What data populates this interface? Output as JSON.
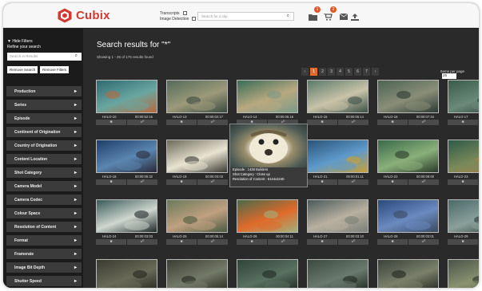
{
  "header": {
    "brand": "Cubix",
    "options": [
      {
        "label": "Transcripts"
      },
      {
        "label": "Image Detection"
      }
    ],
    "search_placeholder": "Search for a clip",
    "badges": {
      "folders": "1",
      "cart": "2"
    }
  },
  "sidebar": {
    "hide_filters": "▼ Hide Filters",
    "refine_label": "Refine your search",
    "search_placeholder": "Search in Results",
    "remove_search": "Remove Search",
    "remove_filters": "Remove Filters",
    "filters": [
      "Production",
      "Series",
      "Episode",
      "Continent of Origination",
      "Country of Origination",
      "Content Location",
      "Shot Category",
      "Camera Model",
      "Camera Codec",
      "Colour Space",
      "Resolution of Content",
      "Format",
      "Framerate",
      "Image Bit Depth",
      "Shutter Speed"
    ]
  },
  "main": {
    "title": "Search results for \"*\"",
    "showing": "Showing 1 - 25 of 175 results found",
    "pages": [
      "‹",
      "1",
      "2",
      "3",
      "4",
      "5",
      "6",
      "7",
      "›"
    ],
    "active_page": "1",
    "items_per_page_label": "Items per page",
    "items_per_page_value": "25",
    "items": [
      {
        "id": "HALO-10",
        "time": "00:00:52:16"
      },
      {
        "id": "HALO-13",
        "time": "00:00:02:17"
      },
      {
        "id": "HALO-14",
        "time": "00:00:05:18"
      },
      {
        "id": "HALO-15",
        "time": "00:00:06:14"
      },
      {
        "id": "HALO-16",
        "time": "00:00:07:34"
      },
      {
        "id": "HALO-17",
        "time": "00:00:"
      },
      {
        "id": "HALO-18",
        "time": "00:00:05:32"
      },
      {
        "id": "HALO-19",
        "time": "00:00:03:03"
      },
      {
        "id": "",
        "time": ""
      },
      {
        "id": "HALO-21",
        "time": "00:00:01:11"
      },
      {
        "id": "HALO-22",
        "time": "00:00:09:00"
      },
      {
        "id": "HALO-23",
        "time": "00:00:"
      },
      {
        "id": "HALO-24",
        "time": "00:00:03:03"
      },
      {
        "id": "HALO-25",
        "time": "00:00:05:14"
      },
      {
        "id": "HALO-26",
        "time": "00:00:04:11"
      },
      {
        "id": "HALO-27",
        "time": "00:00:03:10"
      },
      {
        "id": "HALO-28",
        "time": "00:00:03:01"
      },
      {
        "id": "HALO-29",
        "time": "00:00:"
      },
      {
        "id": "",
        "time": ""
      },
      {
        "id": "",
        "time": ""
      },
      {
        "id": "",
        "time": ""
      },
      {
        "id": "",
        "time": ""
      },
      {
        "id": "",
        "time": ""
      },
      {
        "id": "",
        "time": ""
      }
    ],
    "tooltip": {
      "episode": "Episode : 1438 Builders",
      "shot_category": "Shot Category : Close up",
      "resolution": "Resolution of Content : 6144x3240"
    }
  },
  "colors": {
    "brand_red": "#d23a31",
    "accent_orange": "#e26a2c",
    "bg_dark": "#2a2a2a"
  }
}
